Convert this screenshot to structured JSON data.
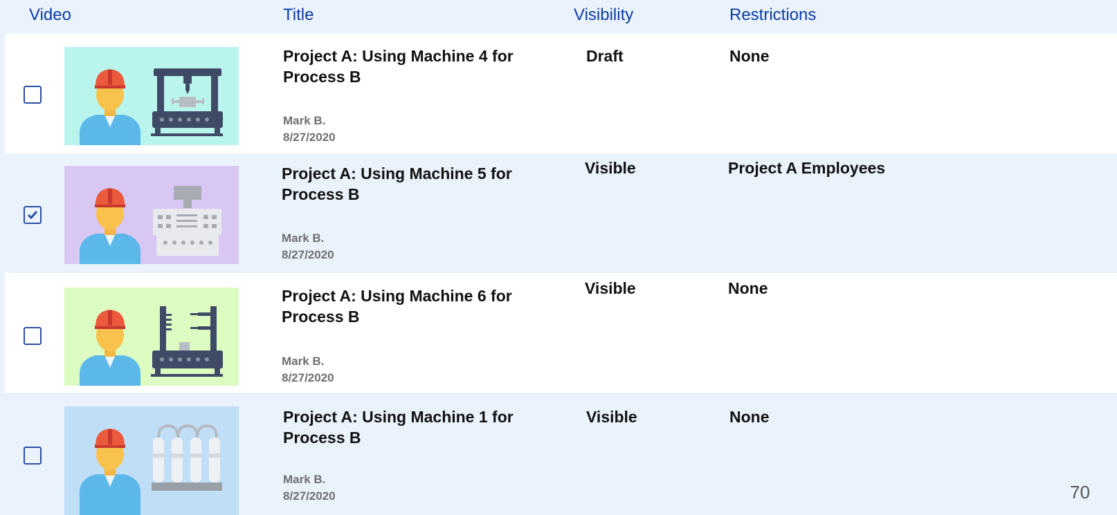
{
  "header": {
    "video": "Video",
    "title": "Title",
    "visibility": "Visibility",
    "restrictions": "Restrictions"
  },
  "rows": [
    {
      "checked": false,
      "thumbnail_bg": "#b9f5ec",
      "thumbnail_icon": "drill-press-machine-icon",
      "title": "Project A: Using Machine 4 for Process B",
      "author": "Mark B.",
      "date": "8/27/2020",
      "visibility": "Draft",
      "restrictions": "None"
    },
    {
      "checked": true,
      "thumbnail_bg": "#d8c6f3",
      "thumbnail_icon": "control-panel-machine-icon",
      "title": "Project A: Using Machine 5 for Process B",
      "author": "Mark B.",
      "date": "8/27/2020",
      "visibility": "Visible",
      "restrictions": "Project A Employees"
    },
    {
      "checked": false,
      "thumbnail_bg": "#dcfcc2",
      "thumbnail_icon": "press-machine-icon",
      "title": "Project A: Using Machine 6 for Process B",
      "author": "Mark B.",
      "date": "8/27/2020",
      "visibility": "Visible",
      "restrictions": "None"
    },
    {
      "checked": false,
      "thumbnail_bg": "#c1def7",
      "thumbnail_icon": "gas-cylinders-icon",
      "title": "Project A: Using Machine 1 for Process B",
      "author": "Mark B.",
      "date": "8/27/2020",
      "visibility": "Visible",
      "restrictions": "None"
    }
  ],
  "page_number": "70"
}
